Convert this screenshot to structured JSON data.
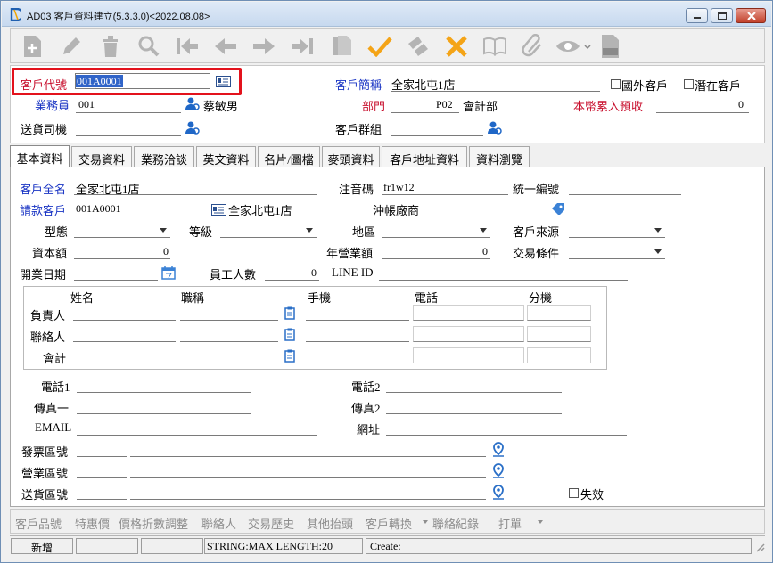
{
  "window": {
    "title": "AD03 客戶資料建立(5.3.3.0)<2022.08.08>"
  },
  "toolbar": {
    "icons": [
      "new-icon",
      "edit-icon",
      "delete-icon",
      "search-icon",
      "first-icon",
      "prev-icon",
      "next-icon",
      "last-icon",
      "copy-icon",
      "confirm-icon",
      "refresh-icon",
      "cancel-icon",
      "book-icon",
      "attachment-icon",
      "view-icon",
      "export-xls-icon"
    ]
  },
  "header": {
    "customer_code_label": "客戶代號",
    "customer_code_value": "001A0001",
    "customer_short_label": "客戶簡稱",
    "customer_short_value": "全家北屯1店",
    "foreign_label": "國外客戶",
    "potential_label": "潛在客戶",
    "salesperson_label": "業務員",
    "salesperson_code": "001",
    "salesperson_name": "蔡敏男",
    "dept_label": "部門",
    "dept_code": "P02",
    "dept_name": "會計部",
    "prepay_label": "本幣累入預收",
    "prepay_value": "0",
    "driver_label": "送貨司機",
    "group_label": "客戶群組"
  },
  "tabs": [
    {
      "label": "基本資料",
      "active": true
    },
    {
      "label": "交易資料"
    },
    {
      "label": "業務洽談"
    },
    {
      "label": "英文資料"
    },
    {
      "label": "名片/圖檔"
    },
    {
      "label": "麥頭資料"
    },
    {
      "label": "客戶地址資料"
    },
    {
      "label": "資料瀏覽"
    }
  ],
  "basic": {
    "full_name_label": "客戶全名",
    "full_name_value": "全家北屯1店",
    "phonetic_label": "注音碼",
    "phonetic_value": "fr1w12",
    "tax_id_label": "統一編號",
    "bill_customer_label": "請款客戶",
    "bill_customer_code": "001A0001",
    "bill_customer_name": "全家北屯1店",
    "account_vendor_label": "沖帳廠商",
    "type_label": "型態",
    "grade_label": "等級",
    "region_label": "地區",
    "source_label": "客戶來源",
    "capital_label": "資本額",
    "capital_value": "0",
    "revenue_label": "年營業額",
    "revenue_value": "0",
    "terms_label": "交易條件",
    "open_date_label": "開業日期",
    "employees_label": "員工人數",
    "employees_value": "0",
    "line_label": "LINE ID",
    "contact_headers": [
      "姓名",
      "職稱",
      "手機",
      "電話",
      "分機"
    ],
    "contact_rows": [
      "負責人",
      "聯絡人",
      "會計"
    ],
    "tel1_label": "電話1",
    "tel2_label": "電話2",
    "fax1_label": "傳真一",
    "fax2_label": "傳真2",
    "email_label": "EMAIL",
    "web_label": "網址",
    "invoice_zip_label": "發票區號",
    "business_zip_label": "營業區號",
    "delivery_zip_label": "送貨區號",
    "invalid_label": "失效"
  },
  "bottom_links": [
    "客戶品號",
    "特惠價",
    "價格折數調整",
    "聯絡人",
    "交易歷史",
    "其他抬頭",
    "客戶轉換",
    "聯絡紀錄",
    "打單"
  ],
  "status": {
    "mode": "新增",
    "field_info": "STRING:MAX LENGTH:20",
    "create_label": "Create:"
  },
  "colors": {
    "label_blue": "#1a35c4",
    "label_red": "#c8102e",
    "highlight": "#e3121c",
    "selection": "#3064c8"
  }
}
